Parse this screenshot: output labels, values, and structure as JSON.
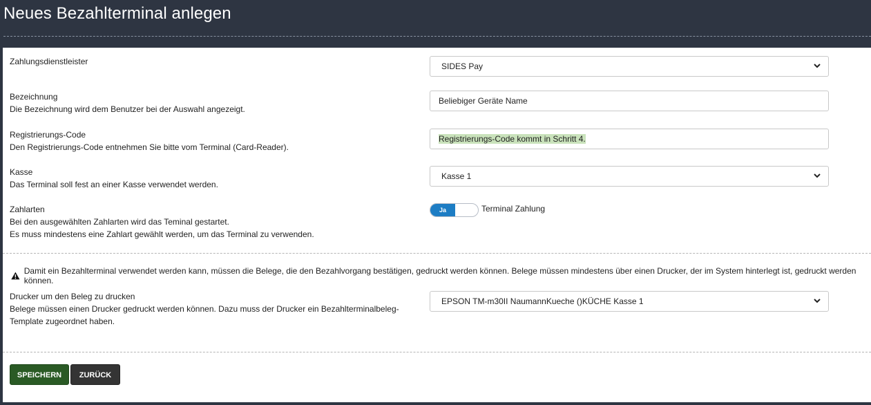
{
  "page": {
    "title": "Neues Bezahlterminal anlegen"
  },
  "form": {
    "provider": {
      "label": "Zahlungsdienstleister",
      "value": "SIDES Pay"
    },
    "name": {
      "label": "Bezeichnung",
      "description": "Die Bezeichnung wird dem Benutzer bei der Auswahl angezeigt.",
      "value": "Beliebiger Geräte Name"
    },
    "registration": {
      "label": "Registrierungs-Code",
      "description": "Den Registrierungs-Code entnehmen Sie bitte vom Terminal (Card-Reader).",
      "value": "Registrierungs-Code kommt in Schritt 4."
    },
    "register": {
      "label": "Kasse",
      "description": "Das Terminal soll fest an einer Kasse verwendet werden.",
      "value": "Kasse 1"
    },
    "payment_types": {
      "label": "Zahlarten",
      "description_1": "Bei den ausgewählten Zahlarten wird das Teminal gestartet.",
      "description_2": "Es muss mindestens eine Zahlart gewählt werden, um das Terminal zu verwenden.",
      "toggle_on_label": "Ja",
      "toggle_state": true,
      "option_label": "Terminal Zahlung"
    },
    "notice": "Damit ein Bezahlterminal verwendet werden kann, müssen die Belege, die den Bezahlvorgang bestätigen, gedruckt werden können. Belege müssen mindestens über einen Drucker, der im System hinterlegt ist, gedruckt werden können.",
    "printer": {
      "label": "Drucker um den Beleg zu drucken",
      "description_1": "Belege müssen einen Drucker gedruckt werden können. Dazu muss der Drucker ein Bezahlterminalbeleg-",
      "description_2": "Template zugeordnet haben.",
      "value": "EPSON TM-m30II NaumannKueche ()KÜCHE Kasse 1"
    }
  },
  "buttons": {
    "save": "SPEICHERN",
    "back": "ZURÜCK"
  },
  "colors": {
    "header_bg": "#2e3542",
    "save_bg": "#2a5a25",
    "back_bg": "#343434",
    "toggle_on": "#1d7dc4",
    "highlight": "#c9e2bb"
  }
}
